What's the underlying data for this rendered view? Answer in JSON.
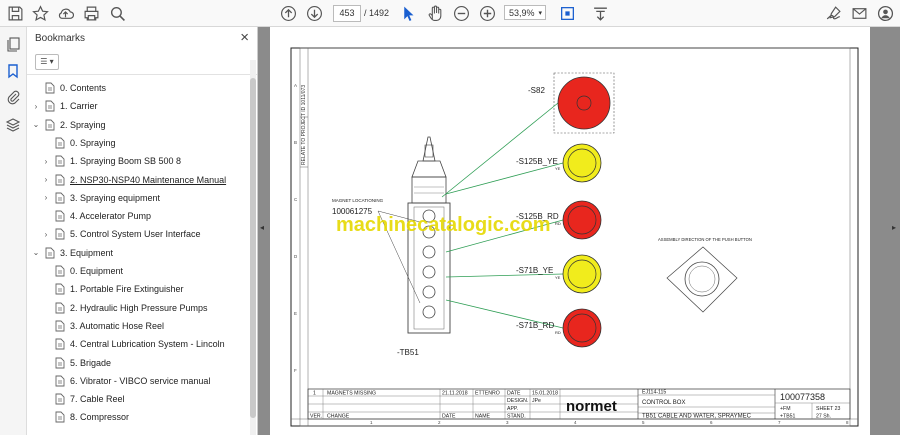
{
  "toolbar": {
    "page_current": "453",
    "page_total": "/ 1492",
    "zoom": "53,9%",
    "icons": [
      "save-icon",
      "bookmark-star-icon",
      "cloud-upload-icon",
      "print-icon",
      "zoom-search-icon",
      "page-up-icon",
      "page-down-icon",
      "select-arrow-icon",
      "hand-icon",
      "zoom-out-icon",
      "zoom-in-icon",
      "fit-page-icon",
      "scroll-mode-icon",
      "sign-icon",
      "email-icon",
      "account-icon"
    ]
  },
  "bookmarks": {
    "title": "Bookmarks",
    "close": "×",
    "menu": "☰ ▾",
    "items": [
      {
        "label": "0. Contents",
        "level": 0,
        "arrow": ""
      },
      {
        "label": "1. Carrier",
        "level": 0,
        "arrow": "›"
      },
      {
        "label": "2. Spraying",
        "level": 0,
        "arrow": "⌄"
      },
      {
        "label": "0. Spraying",
        "level": 1,
        "arrow": ""
      },
      {
        "label": "1. Spraying Boom SB 500 8",
        "level": 1,
        "arrow": "›"
      },
      {
        "label": "2. NSP30-NSP40 Maintenance Manual",
        "level": 1,
        "arrow": "›"
      },
      {
        "label": "3. Spraying equipment",
        "level": 1,
        "arrow": "›"
      },
      {
        "label": "4. Accelerator Pump",
        "level": 1,
        "arrow": ""
      },
      {
        "label": "5. Control System User Interface",
        "level": 1,
        "arrow": "›"
      },
      {
        "label": "3. Equipment",
        "level": 0,
        "arrow": "⌄"
      },
      {
        "label": "0. Equipment",
        "level": 1,
        "arrow": ""
      },
      {
        "label": "1. Portable Fire Extinguisher",
        "level": 1,
        "arrow": ""
      },
      {
        "label": "2. Hydraulic High Pressure Pumps",
        "level": 1,
        "arrow": ""
      },
      {
        "label": "3. Automatic Hose Reel",
        "level": 1,
        "arrow": ""
      },
      {
        "label": "4. Central Lubrication System - Lincoln",
        "level": 1,
        "arrow": ""
      },
      {
        "label": "5. Brigade",
        "level": 1,
        "arrow": ""
      },
      {
        "label": "6. Vibrator - VIBCO service manual",
        "level": 1,
        "arrow": ""
      },
      {
        "label": "7. Cable Reel",
        "level": 1,
        "arrow": ""
      },
      {
        "label": "8. Compressor",
        "level": 1,
        "arrow": ""
      }
    ]
  },
  "drawing": {
    "side_label": "RELATE TO PROJECT ID 1011/073",
    "magnet_title": "MAGNET LOCATIONING",
    "magnet_id": "100061275",
    "pendant_label": "-TB51",
    "watermark": "machinecatalogic.com",
    "assembly_note": "ASSEMBLY DIRECTION OF THE PUSH BUTTON",
    "buttons": [
      {
        "label": "-S82",
        "sub": "",
        "color": "#e8261e"
      },
      {
        "label": "-S125B_YE",
        "sub": "YE",
        "color": "#f1ec1c"
      },
      {
        "label": "-S125B_RD",
        "sub": "RD",
        "color": "#e8261e"
      },
      {
        "label": "-S71B_YE",
        "sub": "YE",
        "color": "#f1ec1c"
      },
      {
        "label": "-S71B_RD",
        "sub": "RD",
        "color": "#e8261e"
      }
    ],
    "title_block": {
      "rev": "1",
      "rev_text": "MAGNETS MISSING",
      "rev_date": "21.11.2018",
      "rev_by": "ETTENRO",
      "date_label": "DATE",
      "date_val": "15.01.2018",
      "design_label": "DESIGN.",
      "design_val": "JPe",
      "app_label": "APP.",
      "ver_label": "VER.",
      "change_label": "CHANGE",
      "date2_label": "DATE",
      "name_label": "NAME",
      "stand_label": "STAND.",
      "brand": "normet",
      "doc_code": "EJ114-115",
      "sheet_title": "CONTROL BOX",
      "sheet_desc": "TB51 CABLE AND WATER, SPRAYMEC",
      "doc_number": "100077358",
      "fpm": "+FM",
      "tb51": "+TB51",
      "sheet": "SHEET 23",
      "sheet_of": "27 Sh."
    },
    "grid_numbers": [
      "1",
      "2",
      "3",
      "4",
      "5",
      "6",
      "7",
      "8"
    ],
    "grid_letters": [
      "A",
      "B",
      "C",
      "D",
      "E",
      "F"
    ]
  }
}
